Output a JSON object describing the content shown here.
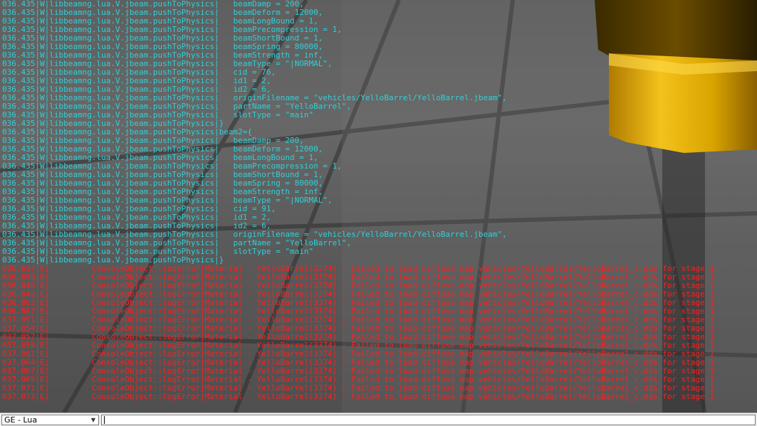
{
  "context_selector": {
    "value": "GE - Lua"
  },
  "command_input": {
    "value": "",
    "placeholder": ""
  },
  "console_lines": [
    {
      "level": "info",
      "text": "036.435|W|libbeamng.lua.V.jbeam.pushToPhysics|   beamDamp = 200,"
    },
    {
      "level": "info",
      "text": "036.435|W|libbeamng.lua.V.jbeam.pushToPhysics|   beamDeform = 12000,"
    },
    {
      "level": "info",
      "text": "036.435|W|libbeamng.lua.V.jbeam.pushToPhysics|   beamLongBound = 1,"
    },
    {
      "level": "info",
      "text": "036.435|W|libbeamng.lua.V.jbeam.pushToPhysics|   beamPrecompression = 1,"
    },
    {
      "level": "info",
      "text": "036.435|W|libbeamng.lua.V.jbeam.pushToPhysics|   beamShortBound = 1,"
    },
    {
      "level": "info",
      "text": "036.435|W|libbeamng.lua.V.jbeam.pushToPhysics|   beamSpring = 80000,"
    },
    {
      "level": "info",
      "text": "036.435|W|libbeamng.lua.V.jbeam.pushToPhysics|   beamStrength = inf,"
    },
    {
      "level": "info",
      "text": "036.435|W|libbeamng.lua.V.jbeam.pushToPhysics|   beamType = \"|NORMAL\","
    },
    {
      "level": "info",
      "text": "036.435|W|libbeamng.lua.V.jbeam.pushToPhysics|   cid = 76,"
    },
    {
      "level": "info",
      "text": "036.435|W|libbeamng.lua.V.jbeam.pushToPhysics|   id1 = 2,"
    },
    {
      "level": "info",
      "text": "036.435|W|libbeamng.lua.V.jbeam.pushToPhysics|   id2 = 6,"
    },
    {
      "level": "info",
      "text": "036.435|W|libbeamng.lua.V.jbeam.pushToPhysics|   originFilename = \"vehicles/YelloBarrel/YelloBarrel.jbeam\","
    },
    {
      "level": "info",
      "text": "036.435|W|libbeamng.lua.V.jbeam.pushToPhysics|   partName = \"YelloBarrel\","
    },
    {
      "level": "info",
      "text": "036.435|W|libbeamng.lua.V.jbeam.pushToPhysics|   slotType = \"main\""
    },
    {
      "level": "info",
      "text": "036.435|W|libbeamng.lua.V.jbeam.pushToPhysics|}"
    },
    {
      "level": "info",
      "text": "036.435|W|libbeamng.lua.V.jbeam.pushToPhysics|beam2={"
    },
    {
      "level": "info",
      "text": "036.435|W|libbeamng.lua.V.jbeam.pushToPhysics|   beamDamp = 200,"
    },
    {
      "level": "info",
      "text": "036.435|W|libbeamng.lua.V.jbeam.pushToPhysics|   beamDeform = 12000,"
    },
    {
      "level": "info",
      "text": "036.435|W|libbeamng.lua.V.jbeam.pushToPhysics|   beamLongBound = 1,"
    },
    {
      "level": "info",
      "text": "036.435|W|libbeamng.lua.V.jbeam.pushToPhysics|   beamPrecompression = 1,"
    },
    {
      "level": "info",
      "text": "036.435|W|libbeamng.lua.V.jbeam.pushToPhysics|   beamShortBound = 1,"
    },
    {
      "level": "info",
      "text": "036.435|W|libbeamng.lua.V.jbeam.pushToPhysics|   beamSpring = 80000,"
    },
    {
      "level": "info",
      "text": "036.435|W|libbeamng.lua.V.jbeam.pushToPhysics|   beamStrength = inf,"
    },
    {
      "level": "info",
      "text": "036.435|W|libbeamng.lua.V.jbeam.pushToPhysics|   beamType = \"|NORMAL\","
    },
    {
      "level": "info",
      "text": "036.435|W|libbeamng.lua.V.jbeam.pushToPhysics|   cid = 91,"
    },
    {
      "level": "info",
      "text": "036.435|W|libbeamng.lua.V.jbeam.pushToPhysics|   id1 = 2,"
    },
    {
      "level": "info",
      "text": "036.435|W|libbeamng.lua.V.jbeam.pushToPhysics|   id2 = 6,"
    },
    {
      "level": "info",
      "text": "036.435|W|libbeamng.lua.V.jbeam.pushToPhysics|   originFilename = \"vehicles/YelloBarrel/YelloBarrel.jbeam\","
    },
    {
      "level": "info",
      "text": "036.435|W|libbeamng.lua.V.jbeam.pushToPhysics|   partName = \"YelloBarrel\","
    },
    {
      "level": "info",
      "text": "036.435|W|libbeamng.lua.V.jbeam.pushToPhysics|   slotType = \"main\""
    },
    {
      "level": "info",
      "text": "036.435|W|libbeamng.lua.V.jbeam.pushToPhysics|}"
    },
    {
      "level": "error",
      "text": "036.697|E|         ConsoleObject::logError|Material - YelloBarrel(3374) - Failed to load diffuse map vehicles/YelloBarrel/YelloBarrel_c.dds for stage 1"
    },
    {
      "level": "error",
      "text": "036.699|E|         ConsoleObject::logError|Material - YelloBarrel(3374) - Failed to load diffuse map vehicles/YelloBarrel/YelloBarrel_c.dds for stage 1"
    },
    {
      "level": "error",
      "text": "036.840|E|         ConsoleObject::logError|Material - YelloBarrel(3374) - Failed to load diffuse map vehicles/YelloBarrel/YelloBarrel_c.dds for stage 1"
    },
    {
      "level": "error",
      "text": "036.842|E|         ConsoleObject::logError|Material - YelloBarrel(3374) - Failed to load diffuse map vehicles/YelloBarrel/YelloBarrel_c.dds for stage 1"
    },
    {
      "level": "error",
      "text": "036.863|E|         ConsoleObject::logError|Material - YelloBarrel(3374) - Failed to load diffuse map vehicles/YelloBarrel/YelloBarrel_c.dds for stage 1"
    },
    {
      "level": "error",
      "text": "036.867|E|         ConsoleObject::logError|Material - YelloBarrel(3374) - Failed to load diffuse map vehicles/YelloBarrel/YelloBarrel_c.dds for stage 1"
    },
    {
      "level": "error",
      "text": "037.051|E|         ConsoleObject::logError|Material - YelloBarrel(3374) - Failed to load diffuse map vehicles/YelloBarrel/YelloBarrel_c.dds for stage 1"
    },
    {
      "level": "error",
      "text": "037.054|E|         ConsoleObject::logError|Material - YelloBarrel(3374) - Failed to load diffuse map vehicles/YelloBarrel/YelloBarrel_c.dds for stage 1"
    },
    {
      "level": "error",
      "text": "037.057|E|         ConsoleObject::logError|Material - YelloBarrel(3374) - Failed to load diffuse map vehicles/YelloBarrel/YelloBarrel_c.dds for stage 1"
    },
    {
      "level": "error",
      "text": "037.059|E|         ConsoleObject::logError|Material - YelloBarrel(3374) - Failed to load diffuse map vehicles/YelloBarrel/YelloBarrel_c.dds for stage 1"
    },
    {
      "level": "error",
      "text": "037.061|E|         ConsoleObject::logError|Material - YelloBarrel(3374) - Failed to load diffuse map vehicles/YelloBarrel/YelloBarrel_c.dds for stage 1"
    },
    {
      "level": "error",
      "text": "037.064|E|         ConsoleObject::logError|Material - YelloBarrel(3374) - Failed to load diffuse map vehicles/YelloBarrel/YelloBarrel_c.dds for stage 1"
    },
    {
      "level": "error",
      "text": "037.067|E|         ConsoleObject::logError|Material - YelloBarrel(3374) - Failed to load diffuse map vehicles/YelloBarrel/YelloBarrel_c.dds for stage 1"
    },
    {
      "level": "error",
      "text": "037.069|E|         ConsoleObject::logError|Material - YelloBarrel(3374) - Failed to load diffuse map vehicles/YelloBarrel/YelloBarrel_c.dds for stage 1"
    },
    {
      "level": "error",
      "text": "037.071|E|         ConsoleObject::logError|Material - YelloBarrel(3374) - Failed to load diffuse map vehicles/YelloBarrel/YelloBarrel_c.dds for stage 1"
    },
    {
      "level": "error",
      "text": "037.073|E|         ConsoleObject::logError|Material - YelloBarrel(3374) - Failed to load diffuse map vehicles/YelloBarrel/YelloBarrel_c.dds for stage 1"
    }
  ],
  "colors": {
    "info_text": "#2fd0d8",
    "error_text": "#ff1f1f",
    "barrel_yellow": "#e8b400"
  },
  "icons": {
    "dropdown": "chevron-down-icon"
  }
}
